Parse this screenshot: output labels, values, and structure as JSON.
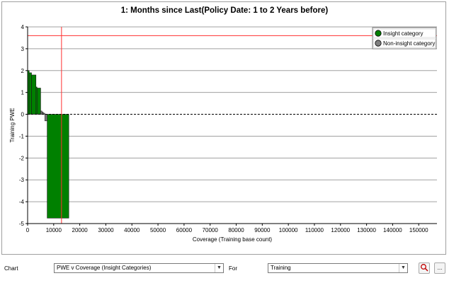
{
  "chart_data": {
    "type": "bar",
    "title": "1: Months since Last(Policy Date: 1 to 2 Years before)",
    "xlabel": "Coverage (Training base count)",
    "ylabel": "Training PWE",
    "xlim": [
      0,
      157000
    ],
    "ylim": [
      -5,
      4
    ],
    "xticks": [
      "0",
      "10000",
      "20000",
      "30000",
      "40000",
      "50000",
      "60000",
      "70000",
      "80000",
      "90000",
      "100000",
      "110000",
      "120000",
      "130000",
      "140000",
      "150000"
    ],
    "yticks": [
      "4",
      "3",
      "2",
      "1",
      "0",
      "-1",
      "-2",
      "-3",
      "-4",
      "-5"
    ],
    "grid": "horizontal",
    "legend_position": "top-right",
    "reference_lines": {
      "vertical_x": 13000,
      "horizontal_y": 3.6
    },
    "series": [
      {
        "name": "Insight category",
        "color": "#008000",
        "bars": [
          {
            "x0": 0,
            "x1": 600,
            "y": 2.0
          },
          {
            "x0": 600,
            "x1": 1500,
            "y": 1.9
          },
          {
            "x0": 1500,
            "x1": 3200,
            "y": 1.8
          },
          {
            "x0": 3200,
            "x1": 3600,
            "y": 1.25
          },
          {
            "x0": 3600,
            "x1": 5000,
            "y": 1.2
          },
          {
            "x0": 7500,
            "x1": 15800,
            "y": -4.75
          }
        ]
      },
      {
        "name": "Non-insight category",
        "color": "#808080",
        "bars": [
          {
            "x0": 5000,
            "x1": 5500,
            "y": 0.15
          },
          {
            "x0": 5500,
            "x1": 6000,
            "y": 0.1
          },
          {
            "x0": 6000,
            "x1": 6600,
            "y": 0.05
          },
          {
            "x0": 6600,
            "x1": 7500,
            "y": -0.3
          }
        ]
      }
    ]
  },
  "controls": {
    "chart_label": "Chart",
    "chart_value": "PWE v Coverage (Insight Categories)",
    "for_label": "For",
    "for_value": "Training",
    "zoom_icon": "magnifier-icon",
    "more_label": "..."
  }
}
